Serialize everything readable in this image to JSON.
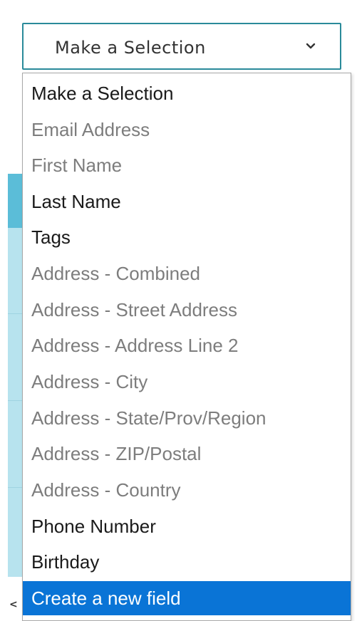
{
  "select": {
    "value": "Make a Selection",
    "chevron_icon": "chevron-down-icon"
  },
  "options": [
    {
      "label": "Make a Selection",
      "state": "enabled"
    },
    {
      "label": "Email Address",
      "state": "disabled"
    },
    {
      "label": "First Name",
      "state": "disabled"
    },
    {
      "label": "Last Name",
      "state": "enabled"
    },
    {
      "label": "Tags",
      "state": "enabled"
    },
    {
      "label": "Address - Combined",
      "state": "disabled"
    },
    {
      "label": "Address - Street Address",
      "state": "disabled"
    },
    {
      "label": "Address - Address Line 2",
      "state": "disabled"
    },
    {
      "label": "Address - City",
      "state": "disabled"
    },
    {
      "label": "Address - State/Prov/Region",
      "state": "disabled"
    },
    {
      "label": "Address - ZIP/Postal",
      "state": "disabled"
    },
    {
      "label": "Address - Country",
      "state": "disabled"
    },
    {
      "label": "Phone Number",
      "state": "enabled"
    },
    {
      "label": "Birthday",
      "state": "enabled"
    },
    {
      "label": "Create a new field",
      "state": "highlighted"
    }
  ],
  "background": {
    "scroll_left_glyph": "<"
  },
  "colors": {
    "select_border": "#2a8a9a",
    "highlight": "#0a74d6",
    "disabled_text": "#7d7d7d",
    "enabled_text": "#1a1a1a",
    "bg_strip": "#b7e3ee"
  }
}
